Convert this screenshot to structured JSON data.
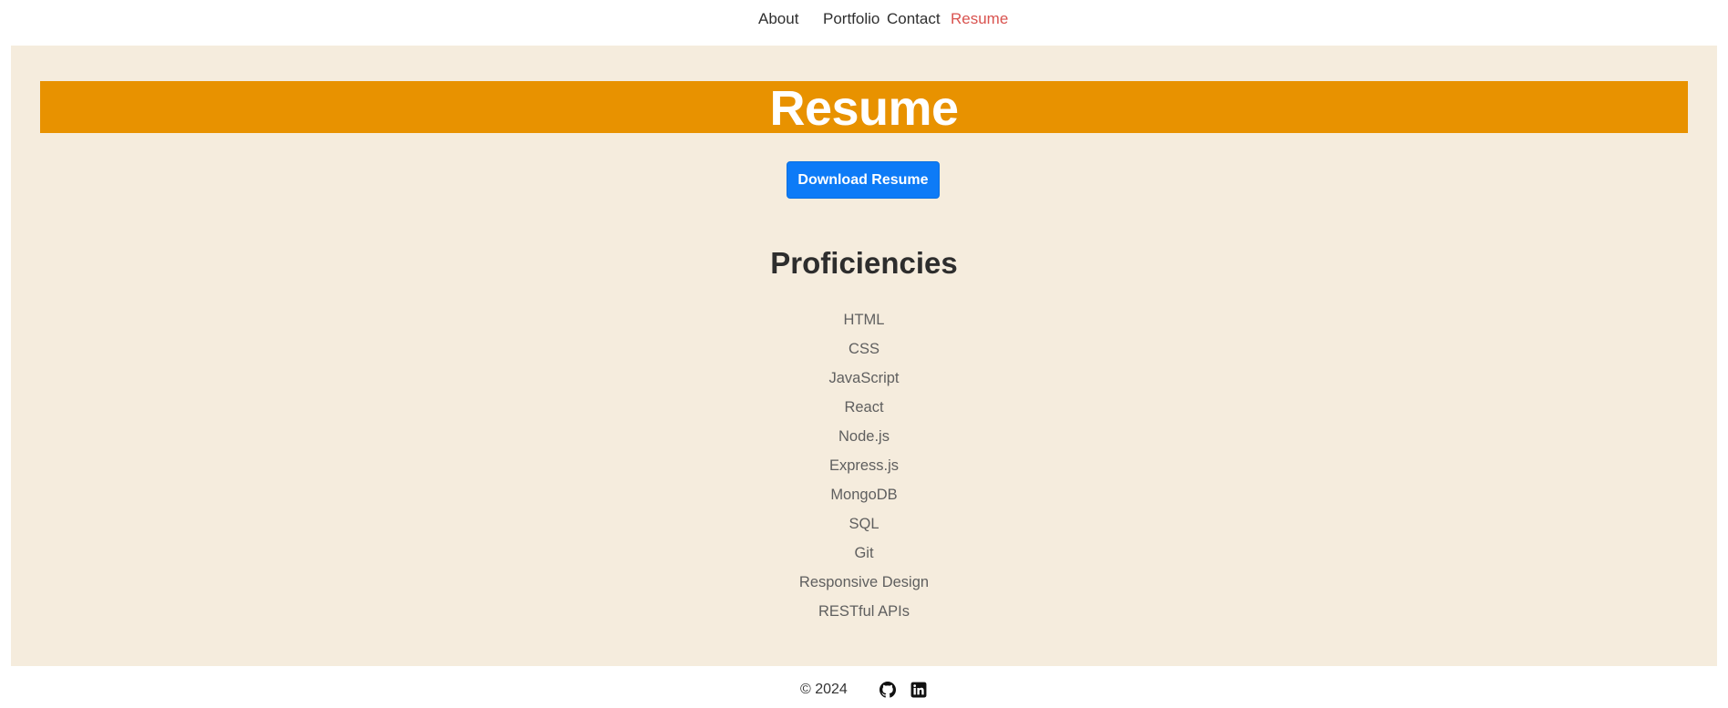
{
  "nav": {
    "items": [
      {
        "label": "About"
      },
      {
        "label": "Portfolio"
      },
      {
        "label": "Contact"
      },
      {
        "label": "Resume",
        "active": true
      }
    ],
    "active_color": "#d9534f"
  },
  "main": {
    "background_color": "#f5ecdd",
    "banner": {
      "title": "Resume",
      "background_color": "#e89200"
    },
    "download_button": {
      "label": "Download Resume",
      "color": "#0d7bf7"
    },
    "proficiencies": {
      "title": "Proficiencies",
      "items": [
        "HTML",
        "CSS",
        "JavaScript",
        "React",
        "Node.js",
        "Express.js",
        "MongoDB",
        "SQL",
        "Git",
        "Responsive Design",
        "RESTful APIs"
      ]
    }
  },
  "footer": {
    "copyright": "© 2024",
    "icons": [
      "github-icon",
      "linkedin-icon"
    ]
  }
}
